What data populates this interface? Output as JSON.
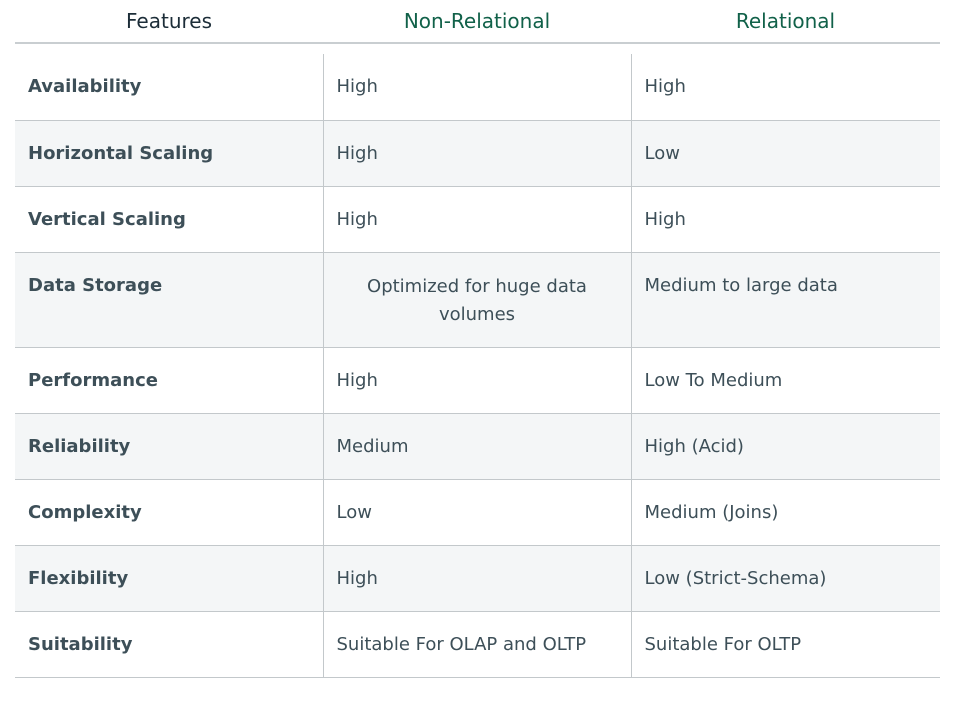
{
  "table": {
    "headers": [
      "Features",
      "Non-Relational",
      "Relational"
    ],
    "rows": [
      {
        "feature": "Availability",
        "non_relational": "High",
        "relational": "High"
      },
      {
        "feature": "Horizontal Scaling",
        "non_relational": "High",
        "relational": "Low"
      },
      {
        "feature": "Vertical Scaling",
        "non_relational": "High",
        "relational": "High"
      },
      {
        "feature": "Data Storage",
        "non_relational": "Optimized for huge data volumes",
        "relational": "Medium to large data"
      },
      {
        "feature": "Performance",
        "non_relational": "High",
        "relational": "Low To Medium"
      },
      {
        "feature": "Reliability",
        "non_relational": "Medium",
        "relational": "High (Acid)"
      },
      {
        "feature": "Complexity",
        "non_relational": "Low",
        "relational": "Medium (Joins)"
      },
      {
        "feature": "Flexibility",
        "non_relational": "High",
        "relational": "Low (Strict-Schema)"
      },
      {
        "feature": "Suitability",
        "non_relational": "Suitable For OLAP and OLTP",
        "relational": "Suitable For OLTP"
      }
    ]
  },
  "colors": {
    "header_text": "#1c2d38",
    "accent_green": "#116149",
    "body_text": "#3d4f58",
    "alt_row_bg": "#f4f6f7",
    "border": "#c3c8cb"
  }
}
